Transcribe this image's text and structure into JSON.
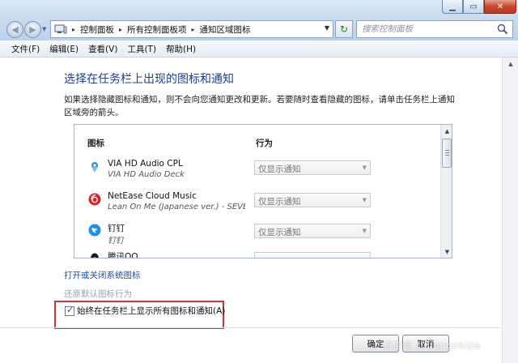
{
  "address_bar": {
    "breadcrumbs": [
      "控制面板",
      "所有控制面板项",
      "通知区域图标"
    ],
    "separator": "▸"
  },
  "search": {
    "placeholder": "搜索控制面板"
  },
  "menu": {
    "items": [
      "文件(F)",
      "编辑(E)",
      "查看(V)",
      "工具(T)",
      "帮助(H)"
    ]
  },
  "main": {
    "title": "选择在任务栏上出现的图标和通知",
    "description": "如果选择隐藏图标和通知，则不会向您通知更改和更新。若要随时查看隐藏的图标，请单击任务栏上通知区域旁的箭头。",
    "columns": {
      "icon": "图标",
      "behavior": "行为"
    },
    "rows": [
      {
        "name": "VIA HD Audio CPL",
        "subtitle": "VIA HD Audio Deck",
        "behavior": "仅显示通知",
        "icon": "via-audio-icon"
      },
      {
        "name": "NetEase Cloud Music",
        "subtitle": "Lean On Me (Japanese ver.) - SEVENT...",
        "behavior": "仅显示通知",
        "icon": "netease-music-icon"
      },
      {
        "name": "钉钉",
        "subtitle": "钉钉",
        "behavior": "仅显示通知",
        "icon": "dingtalk-icon"
      },
      {
        "name": "腾讯QQ",
        "subtitle": "",
        "behavior": "",
        "icon": "qq-icon"
      }
    ],
    "link_toggle_system_icons": "打开或关闭系统图标",
    "link_restore_default": "还原默认图标行为",
    "always_show_label": "始终在任务栏上显示所有图标和通知(A)",
    "always_show_checked": true,
    "ok_label": "确定",
    "cancel_label": "取消"
  },
  "watermark": "百度号 / lilongzhijia",
  "colors": {
    "title_blue": "#1e3e8c",
    "link_blue": "#1f4ea8",
    "highlight_red": "#c6373a",
    "close_red": "#c9462c"
  }
}
